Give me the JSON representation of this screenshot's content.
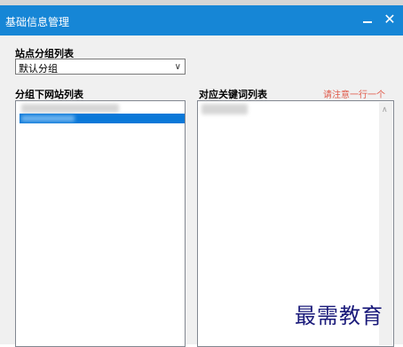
{
  "window": {
    "title": "基础信息管理",
    "minimize_label": "",
    "close_label": "✕"
  },
  "site_group": {
    "label": "站点分组列表",
    "selected": "默认分组"
  },
  "site_list": {
    "label": "分组下网站列表"
  },
  "keyword_list": {
    "label": "对应关键词列表",
    "hint": "请注意一行一个"
  },
  "watermark": "最需教育",
  "colors": {
    "titlebar": "#1686d6",
    "selection": "#0a78d8",
    "hint": "#e05a4a"
  }
}
